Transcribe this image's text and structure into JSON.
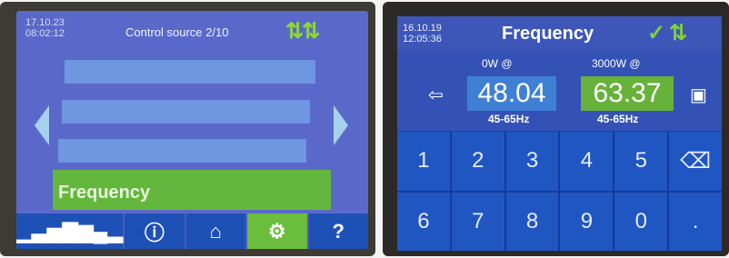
{
  "left_screen": {
    "date": "17.10.23",
    "time": "08:02:12",
    "title": "Control source 2/10",
    "selected_item": "Frequency",
    "status_icon": "swap-arrows-icon",
    "nav": [
      {
        "icon": "histogram-icon",
        "glyph": "▁▃▅▇▆▄▂"
      },
      {
        "icon": "info-icon",
        "glyph": "ⓘ"
      },
      {
        "icon": "home-icon",
        "glyph": "⌂"
      },
      {
        "icon": "gear-icon",
        "glyph": "⚙"
      },
      {
        "icon": "help-icon",
        "glyph": "?"
      }
    ]
  },
  "right_screen": {
    "date": "16.10.19",
    "time": "12:05:36",
    "title": "Frequency",
    "power_low": "0W @",
    "power_high": "3000W @",
    "value_low": "48.04",
    "value_high": "63.37",
    "range_low": "45-65Hz",
    "range_high": "45-65Hz",
    "keys": [
      "1",
      "2",
      "3",
      "4",
      "5",
      "⌫",
      "6",
      "7",
      "8",
      "9",
      "0",
      "."
    ]
  },
  "colors": {
    "left_background": "#5a69c9",
    "left_highlight": "#64b73d",
    "right_background": "#1c3fa6",
    "accent_green": "#7ed13a"
  }
}
